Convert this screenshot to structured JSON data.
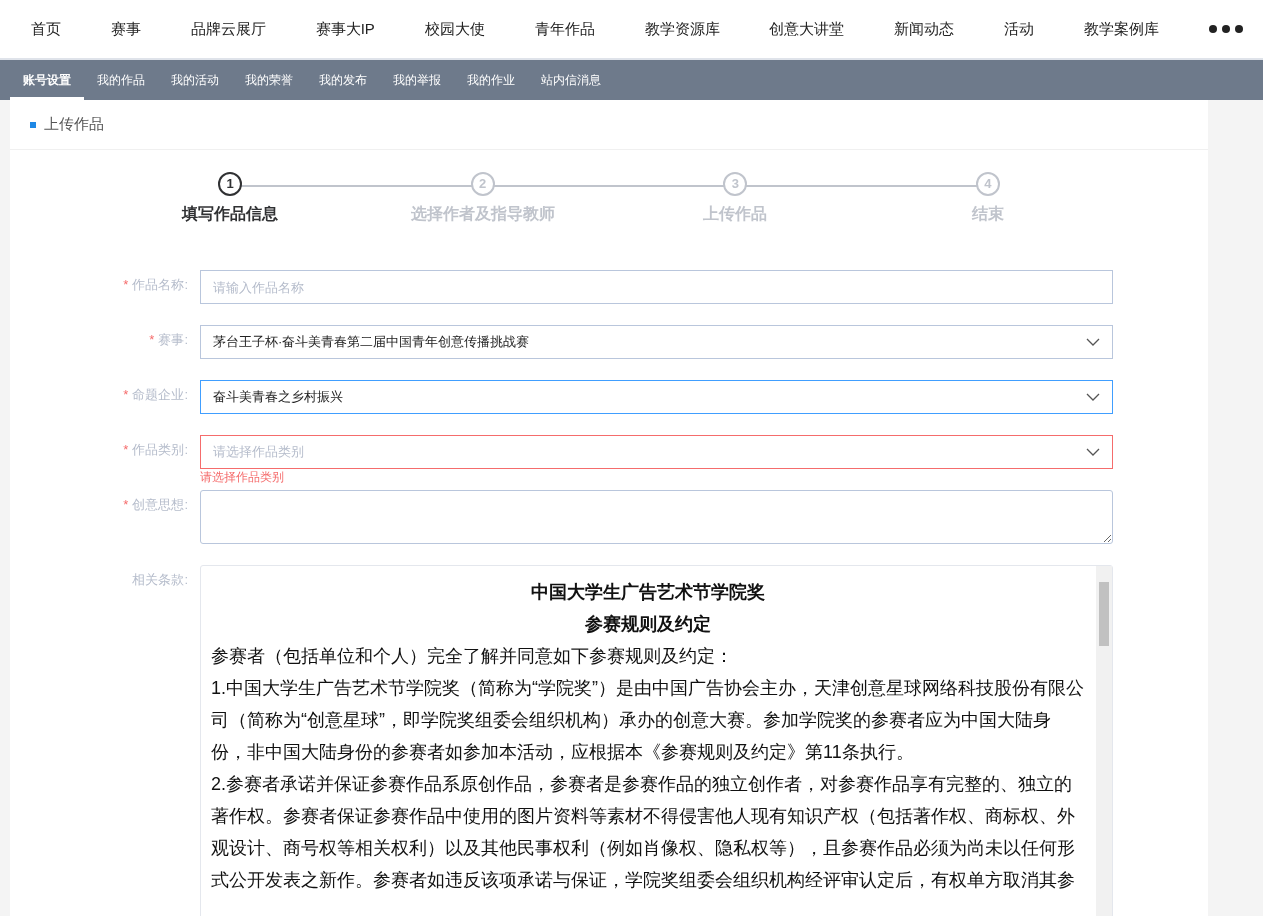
{
  "top_nav": {
    "items": [
      "首页",
      "赛事",
      "品牌云展厅",
      "赛事大IP",
      "校园大使",
      "青年作品",
      "教学资源库",
      "创意大讲堂",
      "新闻动态",
      "活动",
      "教学案例库"
    ]
  },
  "sub_nav": {
    "items": [
      {
        "label": "账号设置",
        "selected": true
      },
      {
        "label": "我的作品",
        "selected": false
      },
      {
        "label": "我的活动",
        "selected": false
      },
      {
        "label": "我的荣誉",
        "selected": false
      },
      {
        "label": "我的发布",
        "selected": false
      },
      {
        "label": "我的举报",
        "selected": false
      },
      {
        "label": "我的作业",
        "selected": false
      },
      {
        "label": "站内信消息",
        "selected": false
      }
    ]
  },
  "card_title": "上传作品",
  "steps": [
    {
      "number": "1",
      "label": "填写作品信息",
      "selected": true
    },
    {
      "number": "2",
      "label": "选择作者及指导教师",
      "selected": false
    },
    {
      "number": "3",
      "label": "上传作品",
      "selected": false
    },
    {
      "number": "4",
      "label": "结束",
      "selected": false
    }
  ],
  "form": [
    {
      "kind": "text",
      "label": "作品名称:",
      "required_mark": "*",
      "placeholder": "请输入作品名称",
      "focused": false
    },
    {
      "kind": "select",
      "label": "赛事:",
      "required_mark": "*",
      "value": "茅台王子杯·奋斗美青春第二届中国青年创意传播挑战赛",
      "focused": false
    },
    {
      "kind": "select",
      "label": "命题企业:",
      "required_mark": "*",
      "value": "奋斗美青春之乡村振兴",
      "focused": true
    },
    {
      "kind": "select",
      "label": "作品类别:",
      "required_mark": "*",
      "placeholder": "请选择作品类别",
      "error": "请选择作品类别",
      "focused": false
    },
    {
      "kind": "textarea",
      "label": "创意思想:",
      "required_mark": "*",
      "focused": false
    }
  ],
  "terms": {
    "label": "相关条款:",
    "titles": [
      "中国大学生广告艺术节学院奖",
      "参赛规则及约定"
    ],
    "paragraphs": [
      "参赛者（包括单位和个人）完全了解并同意如下参赛规则及约定：",
      "1.中国大学生广告艺术节学院奖（简称为“学院奖”）是由中国广告协会主办，天津创意星球网络科技股份有限公司（简称为“创意星球”，即学院奖组委会组织机构）承办的创意大赛。参加学院奖的参赛者应为中国大陆身份，非中国大陆身份的参赛者如参加本活动，应根据本《参赛规则及约定》第11条执行。",
      "2.参赛者承诺并保证参赛作品系原创作品，参赛者是参赛作品的独立创作者，对参赛作品享有完整的、独立的著作权。参赛者保证参赛作品中使用的图片资料等素材不得侵害他人现有知识产权（包括著作权、商标权、外观设计、商号权等相关权利）以及其他民事权利（例如肖像权、隐私权等），且参赛作品必须为尚未以任何形式公开发表之新作。参赛者如违反该项承诺与保证，学院奖组委会组织机构经评审认定后，有权单方取消其参"
    ]
  }
}
